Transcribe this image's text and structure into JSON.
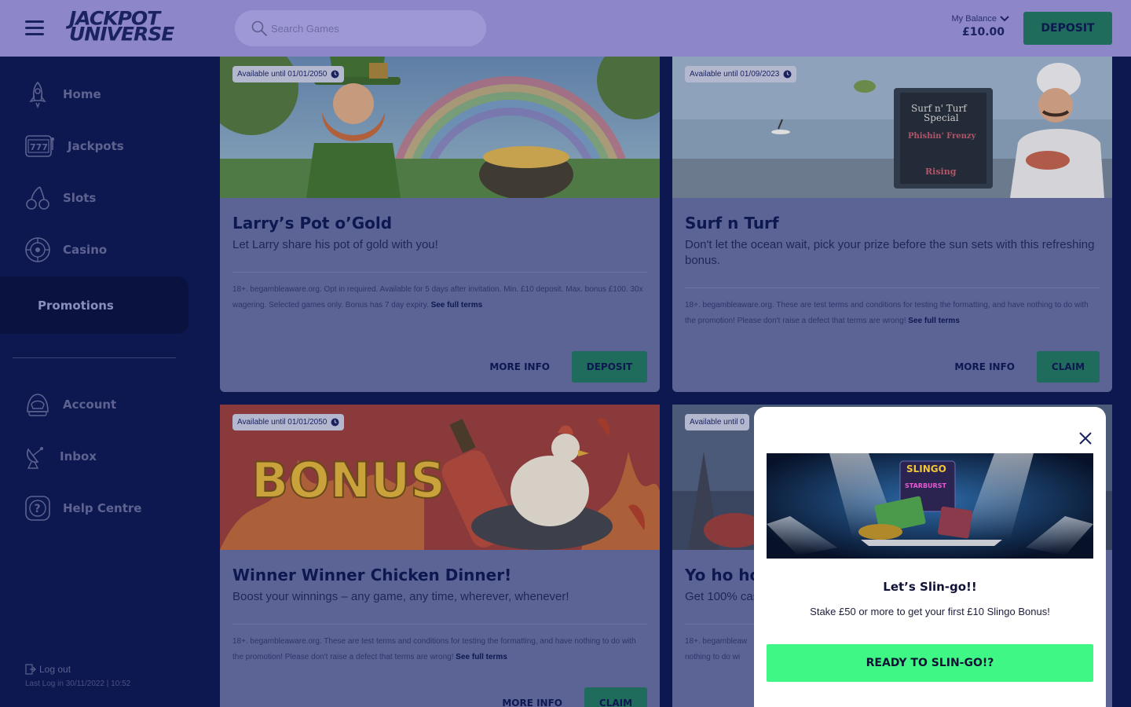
{
  "header": {
    "logo_line1": "JACKPOT",
    "logo_line2": "UNIVERSE",
    "search_placeholder": "Search Games",
    "balance_label": "My Balance",
    "balance_amount": "£10.00",
    "deposit_label": "DEPOSIT"
  },
  "sidebar": {
    "items": [
      {
        "label": "Home",
        "icon": "rocket-icon"
      },
      {
        "label": "Jackpots",
        "icon": "slot-777-icon"
      },
      {
        "label": "Slots",
        "icon": "cherries-icon"
      },
      {
        "label": "Casino",
        "icon": "roulette-icon"
      }
    ],
    "active_item": "Promotions",
    "account_items": [
      {
        "label": "Account",
        "icon": "astronaut-helmet-icon"
      },
      {
        "label": "Inbox",
        "icon": "satellite-dish-icon"
      },
      {
        "label": "Help Centre",
        "icon": "help-question-icon"
      }
    ],
    "logout_label": "Log out",
    "last_log": "Last Log in 30/11/2022 | 10:52"
  },
  "promotions": [
    {
      "availability": "Available until 01/01/2050",
      "title": "Larry’s Pot o’Gold",
      "subtitle": "Let Larry share his pot of gold with you!",
      "terms": "18+. begambleaware.org. Opt in required. Available for 5 days after invitation. Min. £10 deposit. Max. bonus £100. 30x wagering. Selected games only. Bonus has 7 day expiry.",
      "terms_link": "See full terms",
      "more_info": "MORE INFO",
      "action": "DEPOSIT"
    },
    {
      "availability": "Available until 01/09/2023",
      "title": "Surf n Turf",
      "subtitle": "Don't let the ocean wait,  pick your prize before the sun sets with this refreshing bonus.",
      "terms": "18+. begambleaware.org. These are test terms and conditions for testing the formatting, and have nothing to do with the promotion! Please don't raise a defect that terms are wrong!",
      "terms_link": "See full terms",
      "more_info": "MORE INFO",
      "action": "CLAIM",
      "image_text": [
        "Surf n' Turf",
        "Special",
        "Phishin' Frenzy",
        "Rising"
      ]
    },
    {
      "availability": "Available until 01/01/2050",
      "title": "Winner Winner Chicken Dinner!",
      "subtitle": "Boost your winnings – any game, any time, wherever, whenever!",
      "terms": "18+. begambleaware.org. These are test terms and conditions for testing the formatting, and have nothing to do with the promotion! Please don't raise a defect that terms are wrong!",
      "terms_link": "See full terms",
      "more_info": "MORE INFO",
      "action": "CLAIM",
      "image_text": "BONUS"
    },
    {
      "availability": "Available until 0",
      "title": "Yo ho ho",
      "subtitle": "Get 100% cas",
      "terms_line1": "18+. begambleaw",
      "terms_line2": "nothing to do wi"
    }
  ],
  "modal": {
    "banner_text": [
      "SLINGO",
      "STARBURST"
    ],
    "title": "Let’s Slin-go!!",
    "text": "Stake £50 or more to get your first £10 Slingo Bonus!",
    "button": "READY TO SLIN-GO!?"
  },
  "colors": {
    "header_bg": "#8d86c9",
    "sidebar_bg": "#0d1850",
    "card_bg": "#5c6495",
    "accent_green": "#3ef784",
    "muted_green": "#1f6b5c"
  }
}
